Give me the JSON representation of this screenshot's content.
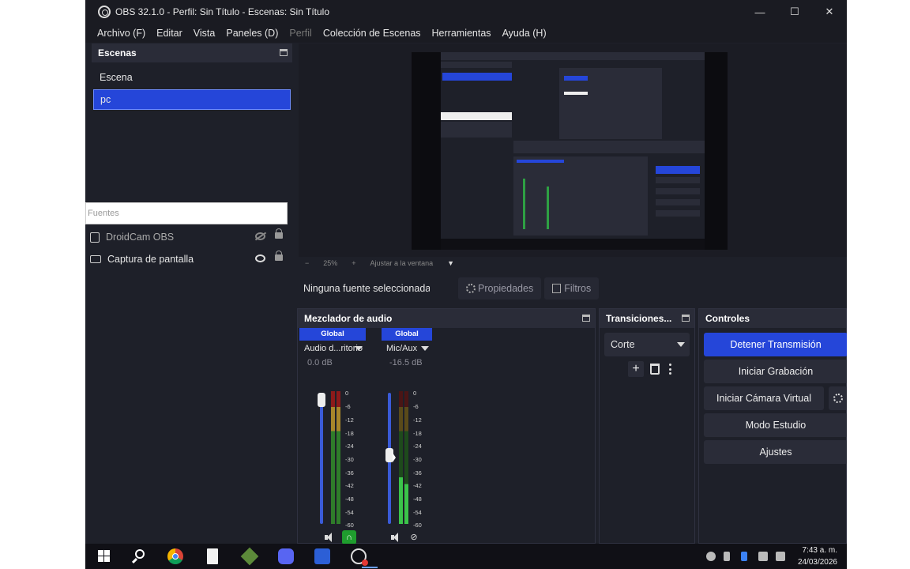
{
  "window": {
    "title": "OBS 32.1.0 - Perfil: Sin Título - Escenas: Sin Título",
    "controls": [
      "—",
      "☐",
      "✕"
    ]
  },
  "menu": {
    "items": [
      "Archivo (F)",
      "Editar",
      "Vista",
      "Paneles (D)",
      "Perfil",
      "Colección de Escenas",
      "Herramientas",
      "Ayuda (H)"
    ]
  },
  "scenes": {
    "header": "Escenas",
    "items": [
      "Escena",
      "pc"
    ],
    "selected": "pc"
  },
  "sources": {
    "filter_placeholder": "Fuentes",
    "items": [
      {
        "name": "DroidCam OBS",
        "visible": false,
        "icon": "camera-icon"
      },
      {
        "name": "Captura de pantalla",
        "visible": true,
        "icon": "monitor-icon"
      }
    ]
  },
  "preview": {
    "zoom_minus": "−",
    "zoom_level": "25%",
    "zoom_plus": "+",
    "fit_label": "Ajustar a la ventana"
  },
  "context_bar": {
    "no_source": "Ninguna fuente seleccionada",
    "properties": "Propiedades",
    "filters": "Filtros"
  },
  "mixer": {
    "header": "Mezclador de audio",
    "channels": [
      {
        "tag": "Global",
        "name": "Audio d...ritorio",
        "db": "0.0 dB",
        "volume_fraction": 1.0
      },
      {
        "tag": "Global",
        "name": "Mic/Aux",
        "db": "-16.5 dB",
        "volume_fraction": 0.53
      }
    ],
    "scale": [
      "0",
      "-6",
      "-12",
      "-18",
      "-24",
      "-30",
      "-36",
      "-42",
      "-48",
      "-54",
      "-60"
    ]
  },
  "transitions": {
    "header": "Transiciones...",
    "selected": "Corte",
    "add": "+"
  },
  "controls": {
    "header": "Controles",
    "stop_stream": "Detener Transmisión",
    "start_record": "Iniciar Grabación",
    "start_vcam": "Iniciar Cámara Virtual",
    "studio_mode": "Modo Estudio",
    "settings": "Ajustes"
  },
  "taskbar": {
    "time": "7:43 a. m.",
    "date": "24/03/2026"
  },
  "colors": {
    "accent": "#2546d9",
    "background": "#1e2029",
    "meter_green": "#1f9d2e"
  }
}
